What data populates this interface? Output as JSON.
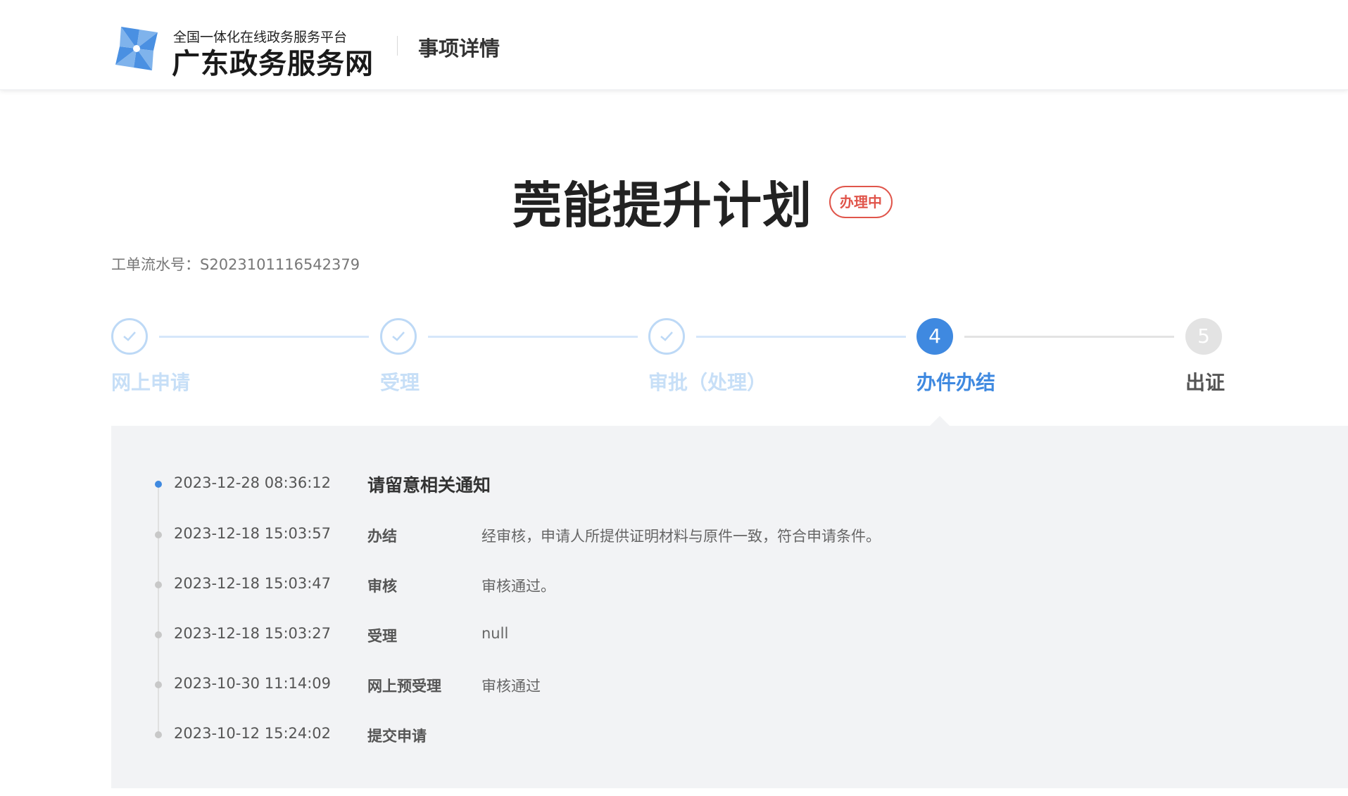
{
  "header": {
    "logo_subtitle": "全国一体化在线政务服务平台",
    "logo_title": "广东政务服务网",
    "page_heading": "事项详情",
    "logo_icon": "pinwheel-logo-icon",
    "brand_color": "#4a90e2"
  },
  "main": {
    "title": "莞能提升计划",
    "status": "办理中",
    "status_color": "#e0554b",
    "serial_label": "工单流水号：",
    "serial_number": "S2023101116542379"
  },
  "steps": [
    {
      "number": "1",
      "label": "网上申请",
      "state": "done"
    },
    {
      "number": "2",
      "label": "受理",
      "state": "done"
    },
    {
      "number": "3",
      "label": "审批（处理）",
      "state": "done"
    },
    {
      "number": "4",
      "label": "办件办结",
      "state": "active"
    },
    {
      "number": "5",
      "label": "出证",
      "state": "pending"
    }
  ],
  "timeline": [
    {
      "time": "2023-12-28 08:36:12",
      "action": "请留意相关通知",
      "desc": ""
    },
    {
      "time": "2023-12-18 15:03:57",
      "action": "办结",
      "desc": "经审核，申请人所提供证明材料与原件一致，符合申请条件。"
    },
    {
      "time": "2023-12-18 15:03:47",
      "action": "审核",
      "desc": "审核通过。"
    },
    {
      "time": "2023-12-18 15:03:27",
      "action": "受理",
      "desc": "null"
    },
    {
      "time": "2023-10-30 11:14:09",
      "action": "网上预受理",
      "desc": "审核通过"
    },
    {
      "time": "2023-10-12 15:24:02",
      "action": "提交申请",
      "desc": ""
    }
  ],
  "colors": {
    "accent": "#3f89e0",
    "done": "#bdd9f6",
    "pending": "#e3e3e3"
  }
}
